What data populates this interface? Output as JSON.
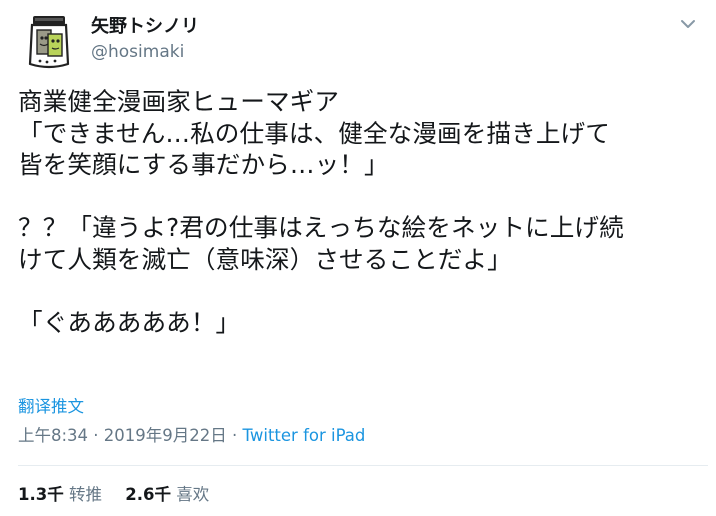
{
  "user": {
    "display_name": "矢野トシノリ",
    "handle": "@hosimaki",
    "avatar_icon": "jar-character-avatar"
  },
  "header": {
    "caret_icon": "chevron-down-icon"
  },
  "tweet": {
    "text": "商業健全漫画家ヒューマギア\n「できません…私の仕事は、健全な漫画を描き上げて\n皆を笑顔にする事だから…ッ！」\n\n？？「違うよ?君の仕事はえっちな絵をネットに上げ続\nけて人類を滅亡（意味深）させることだよ」\n\n「ぐあああああ！」",
    "translate_label": "翻译推文"
  },
  "meta": {
    "timestamp": "上午8:34 · 2019年9月22日",
    "separator": " · ",
    "source": "Twitter for iPad"
  },
  "stats": {
    "retweets_count": "1.3千",
    "retweets_label": "转推",
    "likes_count": "2.6千",
    "likes_label": "喜欢"
  },
  "colors": {
    "link": "#1b95e0",
    "secondary_text": "#657786",
    "primary_text": "#14171a",
    "divider": "#e6ecf0"
  }
}
